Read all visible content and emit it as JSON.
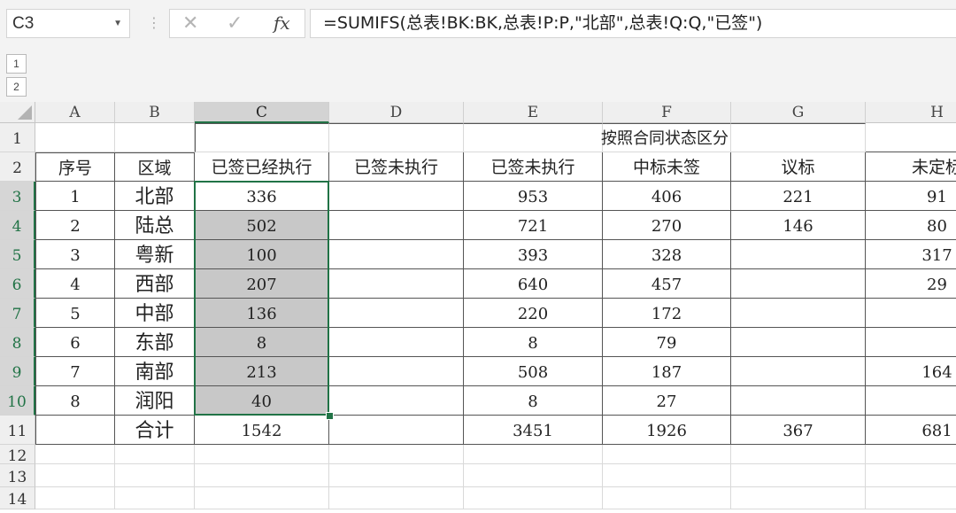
{
  "formula_bar": {
    "name_box": "C3",
    "cancel_glyph": "✕",
    "enter_glyph": "✓",
    "fx_label": "fx",
    "formula": "=SUMIFS(总表!BK:BK,总表!P:P,\"北部\",总表!Q:Q,\"已签\")"
  },
  "outline": {
    "levels": [
      "1",
      "2"
    ]
  },
  "columns": [
    "A",
    "B",
    "C",
    "D",
    "E",
    "F",
    "G",
    "H"
  ],
  "selected_column": "C",
  "rows": [
    "1",
    "2",
    "3",
    "4",
    "5",
    "6",
    "7",
    "8",
    "9",
    "10",
    "11",
    "12",
    "13",
    "14"
  ],
  "sheet": {
    "group_title": "按照合同状态区分",
    "headers": [
      "序号",
      "区域",
      "已签已经执行",
      "已签未执行",
      "已签未执行",
      "中标未签",
      "议标",
      "未定标"
    ],
    "data": [
      [
        "1",
        "北部",
        "336",
        "",
        "953",
        "406",
        "221",
        "91"
      ],
      [
        "2",
        "陆总",
        "502",
        "",
        "721",
        "270",
        "146",
        "80"
      ],
      [
        "3",
        "粤新",
        "100",
        "",
        "393",
        "328",
        "",
        "317"
      ],
      [
        "4",
        "西部",
        "207",
        "",
        "640",
        "457",
        "",
        "29"
      ],
      [
        "5",
        "中部",
        "136",
        "",
        "220",
        "172",
        "",
        ""
      ],
      [
        "6",
        "东部",
        "8",
        "",
        "8",
        "79",
        "",
        ""
      ],
      [
        "7",
        "南部",
        "213",
        "",
        "508",
        "187",
        "",
        "164"
      ],
      [
        "8",
        "润阳",
        "40",
        "",
        "8",
        "27",
        "",
        ""
      ]
    ],
    "total": [
      "",
      "合计",
      "1542",
      "",
      "3451",
      "1926",
      "367",
      "681"
    ]
  },
  "colors": {
    "accent": "#217346",
    "selection_fill": "#c8c8c8"
  }
}
